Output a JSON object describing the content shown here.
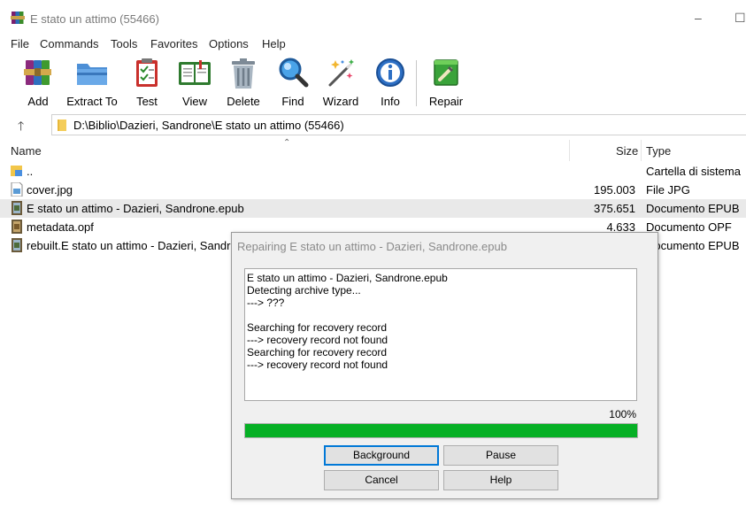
{
  "window": {
    "title": "E stato un attimo (55466)",
    "minimize_glyph": "–",
    "maximize_glyph": "☐"
  },
  "menu": [
    "File",
    "Commands",
    "Tools",
    "Favorites",
    "Options",
    "Help"
  ],
  "toolbar": {
    "buttons": [
      {
        "label": "Add",
        "icon": "add-archive-icon"
      },
      {
        "label": "Extract To",
        "icon": "extract-folder-icon"
      },
      {
        "label": "Test",
        "icon": "test-clipboard-icon"
      },
      {
        "label": "View",
        "icon": "view-book-icon"
      },
      {
        "label": "Delete",
        "icon": "trash-icon"
      },
      {
        "label": "Find",
        "icon": "magnifier-icon"
      },
      {
        "label": "Wizard",
        "icon": "magic-wand-icon"
      },
      {
        "label": "Info",
        "icon": "info-icon"
      },
      {
        "label": "Repair",
        "icon": "repair-icon"
      }
    ]
  },
  "address": {
    "path": "D:\\Biblio\\Dazieri, Sandrone\\E stato un attimo (55466)"
  },
  "list": {
    "columns": {
      "name": "Name",
      "size": "Size",
      "type": "Type"
    },
    "rows": [
      {
        "name": "..",
        "size": "",
        "type": "Cartella di sistema",
        "icon": "parent-folder-icon"
      },
      {
        "name": "cover.jpg",
        "size": "195.003",
        "type": "File JPG",
        "icon": "image-file-icon"
      },
      {
        "name": "E stato un attimo - Dazieri, Sandrone.epub",
        "size": "375.651",
        "type": "Documento EPUB",
        "icon": "epub-file-icon"
      },
      {
        "name": "metadata.opf",
        "size": "4.633",
        "type": "Documento OPF",
        "icon": "opf-file-icon"
      },
      {
        "name": "rebuilt.E stato un attimo - Dazieri, Sandrone.epub",
        "size": "",
        "type": "Documento EPUB",
        "icon": "epub-file-icon"
      }
    ]
  },
  "dialog": {
    "title": "Repairing E stato un attimo - Dazieri, Sandrone.epub",
    "log": [
      "E stato un attimo - Dazieri, Sandrone.epub",
      "Detecting archive type...",
      "---> ???",
      "",
      "Searching for recovery record",
      "---> recovery record not found",
      "Searching for recovery record",
      "---> recovery record not found"
    ],
    "progress_label": "100%",
    "progress_fraction": 1.0,
    "buttons": {
      "background": "Background",
      "pause": "Pause",
      "cancel": "Cancel",
      "help": "Help"
    }
  },
  "colors": {
    "progress": "#06b025",
    "selected_row": "#e9e9e9",
    "default_button_border": "#0078d7"
  }
}
